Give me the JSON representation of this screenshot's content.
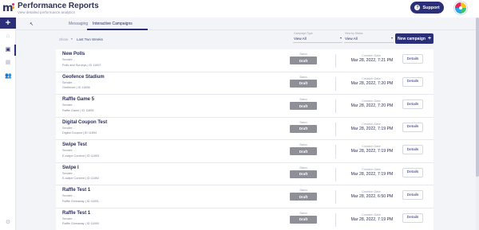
{
  "header": {
    "title": "Performance Reports",
    "subtitle": "View detailed performance analytics",
    "support_label": "Support",
    "support_icon": "question-circle-icon"
  },
  "sidebar": {
    "add_label": "+",
    "items": [
      {
        "icon": "home-icon",
        "glyph": "⌂"
      },
      {
        "icon": "reports-icon",
        "glyph": "▣",
        "active": true
      },
      {
        "icon": "grid-icon",
        "glyph": "▦"
      },
      {
        "icon": "users-icon",
        "glyph": "👥"
      }
    ],
    "settings_glyph": "⚙"
  },
  "tabs": [
    {
      "label": "Messaging"
    },
    {
      "label": "Interactive Campaigns",
      "active": true
    }
  ],
  "filters": {
    "show_label": "Show",
    "show_value": "Last Two Weeks",
    "campaign_type": {
      "label": "Campaign Type",
      "value": "View All"
    },
    "view_by_status": {
      "label": "View by Status",
      "value": "View All"
    },
    "new_campaign_label": "New campaign"
  },
  "labels": {
    "status": "Status",
    "creation_date": "Creation Date",
    "details": "Details"
  },
  "campaigns": [
    {
      "title": "New Polls",
      "sender": "Sender: -",
      "meta": "Polls and Surveys | ID 11897",
      "status": "Draft",
      "date": "Mar 28, 2022, 7:21 PM"
    },
    {
      "title": "Geofence Stadium",
      "sender": "Sender: -",
      "meta": "Geofence | ID 11896",
      "status": "Draft",
      "date": "Mar 28, 2022, 7:20 PM"
    },
    {
      "title": "Raffle Game 5",
      "sender": "Sender: -",
      "meta": "Raffle Game | ID 11895",
      "status": "Draft",
      "date": "Mar 28, 2022, 7:20 PM"
    },
    {
      "title": "Digital Coupon Test",
      "sender": "Sender: -",
      "meta": "Digital Coupon | ID 11894",
      "status": "Draft",
      "date": "Mar 28, 2022, 7:19 PM"
    },
    {
      "title": "Swipe Test",
      "sender": "Sender: -",
      "meta": "E-swipe Content | ID 11893",
      "status": "Draft",
      "date": "Mar 28, 2022, 7:19 PM"
    },
    {
      "title": "Swipe I",
      "sender": "Sender: -",
      "meta": "E-swipe Content | ID 11892",
      "status": "Draft",
      "date": "Mar 28, 2022, 7:19 PM"
    },
    {
      "title": "Raffle Test 1",
      "sender": "Sender: -",
      "meta": "Raffle Giveaway | ID 11891",
      "status": "Draft",
      "date": "Mar 28, 2022, 6:50 PM"
    },
    {
      "title": "Raffle Test 1",
      "sender": "Sender: -",
      "meta": "Raffle Giveaway | ID 11890",
      "status": "Draft",
      "date": "Mar 28, 2022, 7:19 PM"
    }
  ],
  "colors": {
    "brand": "#2b2f78",
    "draft_badge": "#8f9097",
    "background": "#f3f4f8"
  }
}
